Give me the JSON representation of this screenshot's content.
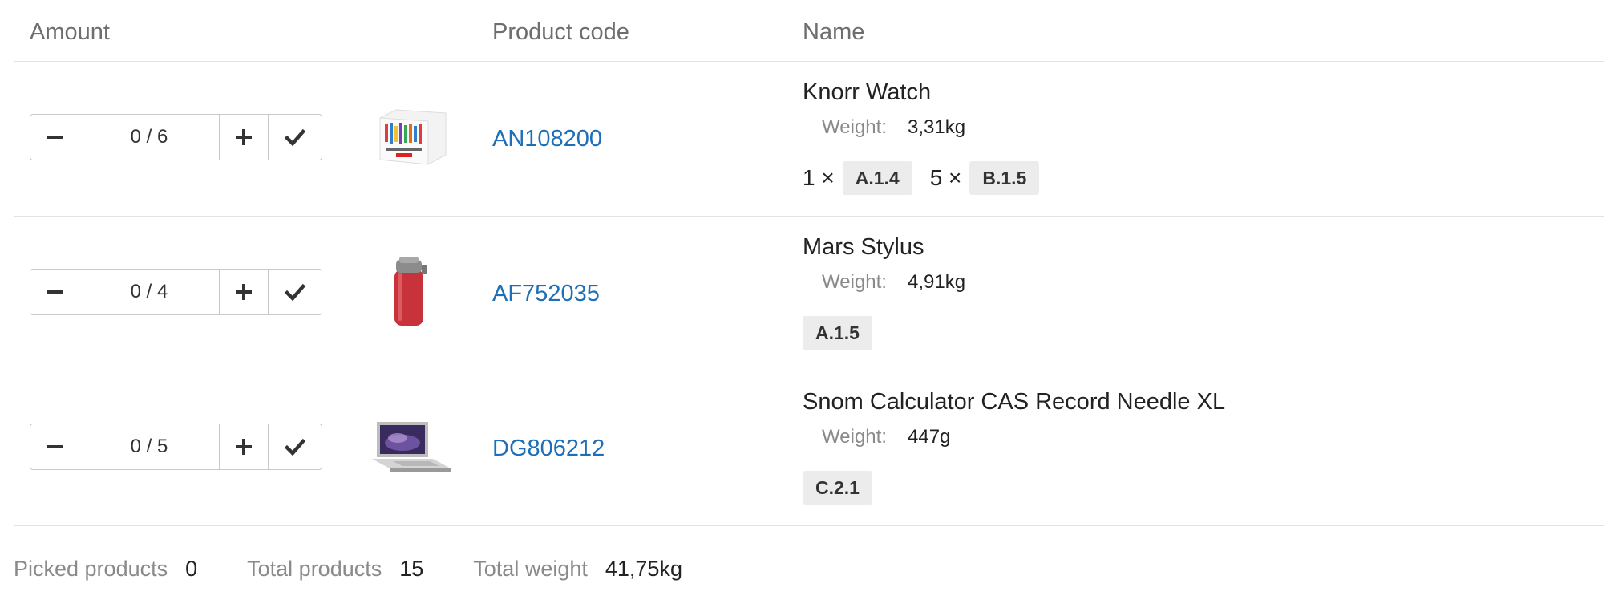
{
  "header": {
    "amount": "Amount",
    "product_code": "Product code",
    "name": "Name"
  },
  "rows": [
    {
      "quantity": "0 / 6",
      "image": "product-box-image",
      "code": "AN108200",
      "name": "Knorr Watch",
      "weight_label": "Weight:",
      "weight": "3,31kg",
      "locations": [
        {
          "mult": "1 ×",
          "loc": "A.1.4"
        },
        {
          "mult": "5 ×",
          "loc": "B.1.5"
        }
      ]
    },
    {
      "quantity": "0 / 4",
      "image": "red-thermos-image",
      "code": "AF752035",
      "name": "Mars Stylus",
      "weight_label": "Weight:",
      "weight": "4,91kg",
      "locations": [
        {
          "loc": "A.1.5"
        }
      ]
    },
    {
      "quantity": "0 / 5",
      "image": "laptop-image",
      "code": "DG806212",
      "name": "Snom Calculator CAS Record Needle XL",
      "weight_label": "Weight:",
      "weight": "447g",
      "locations": [
        {
          "loc": "C.2.1"
        }
      ]
    }
  ],
  "footer": {
    "picked_label": "Picked products",
    "picked_value": "0",
    "total_label": "Total products",
    "total_value": "15",
    "weight_label": "Total weight",
    "weight_value": "41,75kg"
  },
  "colors": {
    "link": "#1e6fb8",
    "muted": "#8a8a8a",
    "badge_bg": "#ececec"
  }
}
